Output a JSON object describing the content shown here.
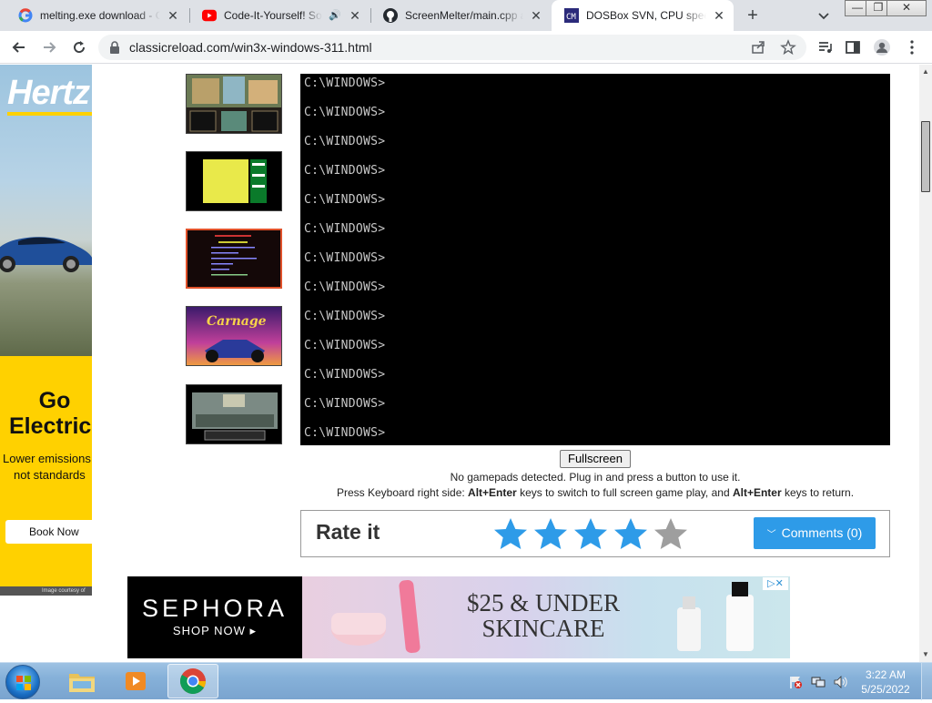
{
  "tabs": [
    {
      "title": "melting.exe download - Google",
      "favicon": "google-icon"
    },
    {
      "title": "Code-It-Yourself! Sound",
      "favicon": "youtube-icon"
    },
    {
      "title": "ScreenMelter/main.cpp at",
      "favicon": "github-icon"
    },
    {
      "title": "DOSBox SVN, CPU speed",
      "favicon": "dosbox-icon",
      "active": true
    }
  ],
  "window_controls": {
    "minimize": "—",
    "maximize": "❐",
    "close": "✕"
  },
  "omnibox": {
    "url": "classicreload.com/win3x-windows-311.html"
  },
  "ad_left": {
    "brand": "Hertz",
    "headline_1": "Go",
    "headline_2": "Electric",
    "sub_1": "Lower emissions",
    "sub_2": "not standards",
    "cta": "Book Now",
    "credit": "Image courtesy of"
  },
  "dos": {
    "lines": [
      "C:\\WINDOWS>",
      "C:\\WINDOWS>",
      "C:\\WINDOWS>",
      "C:\\WINDOWS>",
      "C:\\WINDOWS>",
      "C:\\WINDOWS>",
      "C:\\WINDOWS>",
      "C:\\WINDOWS>",
      "C:\\WINDOWS>",
      "C:\\WINDOWS>",
      "C:\\WINDOWS>",
      "C:\\WINDOWS>",
      "C:\\WINDOWS>"
    ]
  },
  "player": {
    "fullscreen_label": "Fullscreen",
    "gamepad_note": "No gamepads detected. Plug in and press a button to use it.",
    "kb_prefix": "Press Keyboard right side: ",
    "kb_key1": "Alt+Enter",
    "kb_middle": " keys to switch to full screen game play, and ",
    "kb_key2": "Alt+Enter",
    "kb_suffix": " keys to return."
  },
  "rating": {
    "title": "Rate it",
    "stars_filled": 4,
    "stars_total": 5,
    "comments_label": "Comments (0)"
  },
  "ad_bottom": {
    "brand": "SEPHORA",
    "shop": "SHOP NOW ▸",
    "headline_1": "$25 & UNDER",
    "headline_2": "SKINCARE",
    "adchoice": "▷✕"
  },
  "taskbar": {
    "time": "3:22 AM",
    "date": "5/25/2022"
  },
  "colors": {
    "accent_blue": "#2e9be8",
    "star_filled": "#2e9be8",
    "star_empty": "#9e9e9e",
    "hertz_yellow": "#ffd100"
  }
}
